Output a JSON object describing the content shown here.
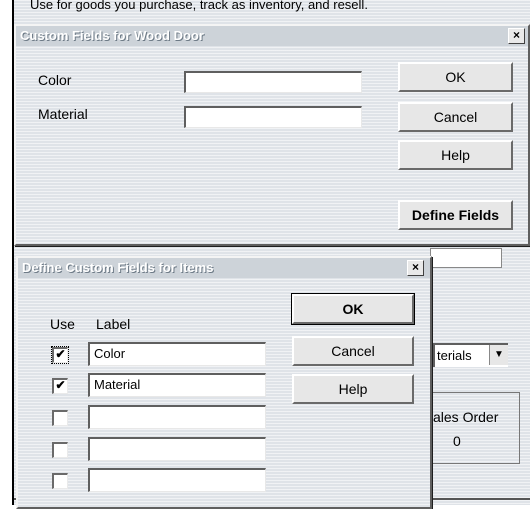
{
  "background": {
    "top_text": "Use for goods you purchase, track as inventory, and resell.",
    "dropdown_value": "terials",
    "sales_order_label": "ales Order",
    "sales_order_value": "0"
  },
  "custom_fields_dialog": {
    "title": "Custom Fields for Wood Door",
    "close_glyph": "×",
    "fields": [
      {
        "label": "Color",
        "value": ""
      },
      {
        "label": "Material",
        "value": ""
      }
    ],
    "buttons": {
      "ok": "OK",
      "cancel": "Cancel",
      "help": "Help",
      "define_fields": "Define Fields"
    }
  },
  "define_dialog": {
    "title": "Define Custom Fields for Items",
    "close_glyph": "×",
    "col_use": "Use",
    "col_label": "Label",
    "check_glyph": "✔",
    "rows": [
      {
        "checked": true,
        "label": "Color"
      },
      {
        "checked": true,
        "label": "Material"
      },
      {
        "checked": false,
        "label": ""
      },
      {
        "checked": false,
        "label": ""
      },
      {
        "checked": false,
        "label": ""
      }
    ],
    "buttons": {
      "ok": "OK",
      "cancel": "Cancel",
      "help": "Help"
    }
  },
  "colors": {
    "title_text": "#ffffff",
    "dialog_bg": "#dfe3e8"
  }
}
